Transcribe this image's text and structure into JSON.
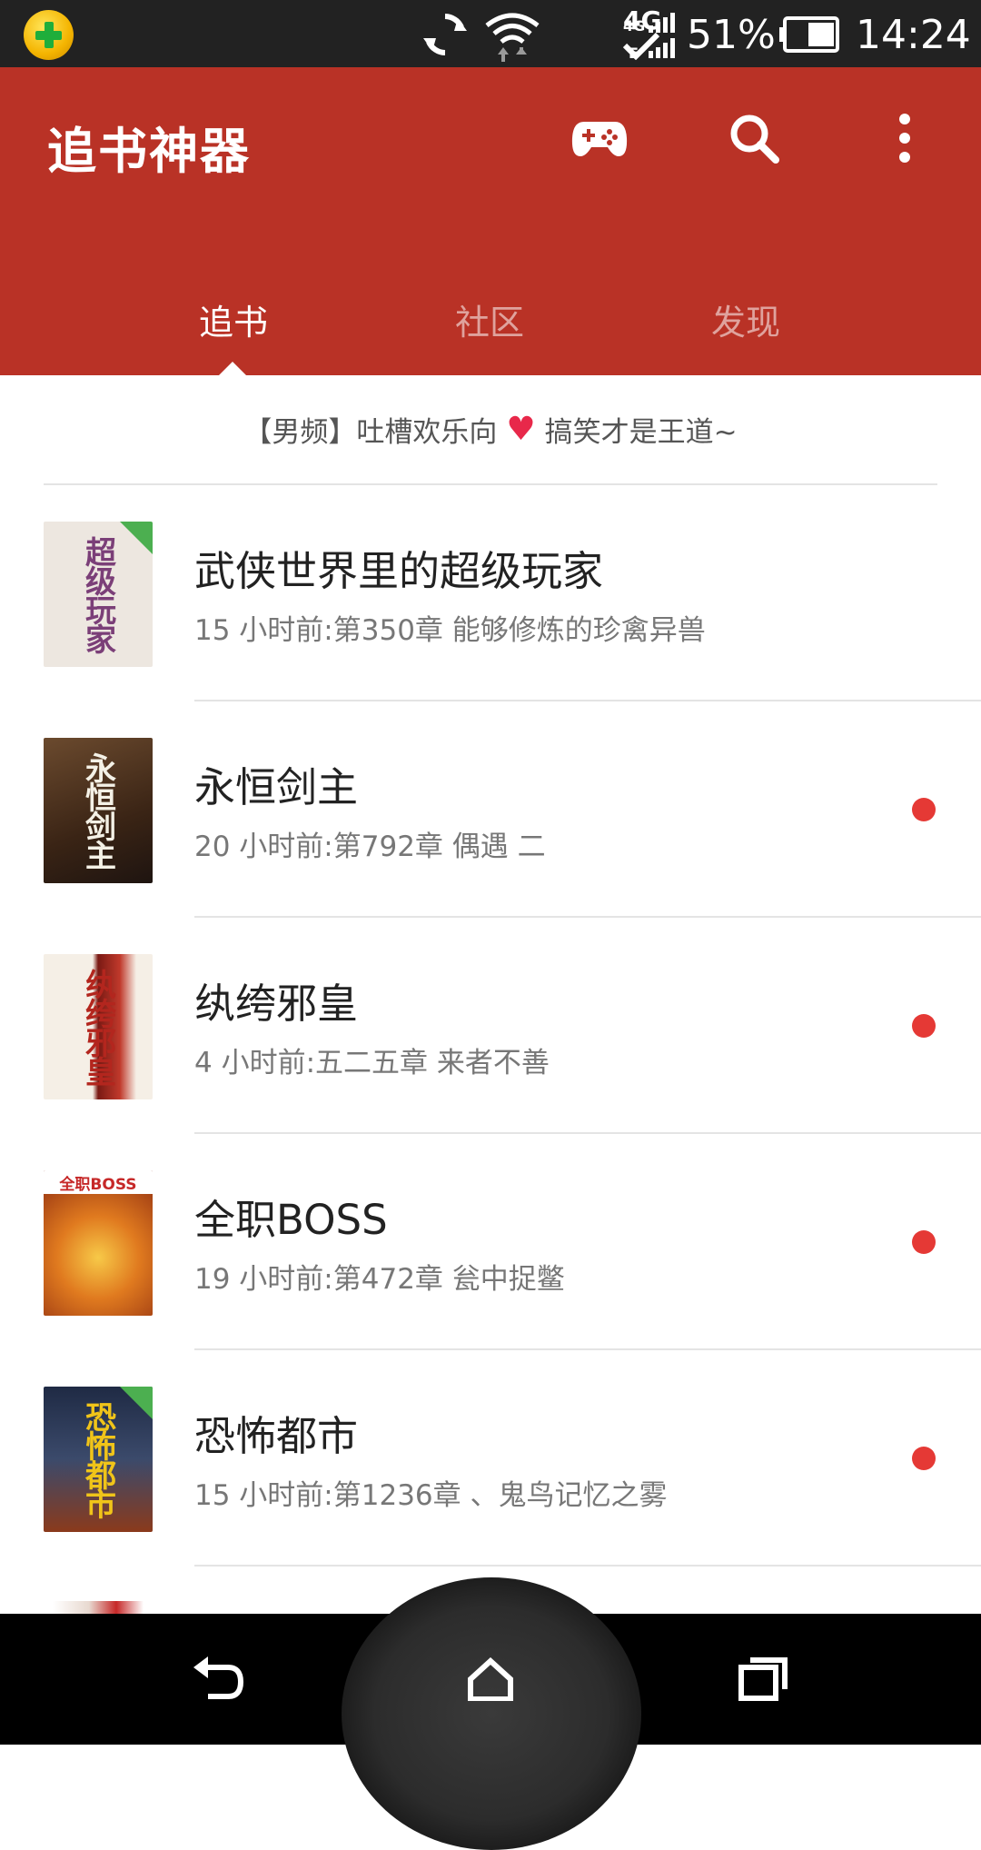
{
  "status_bar": {
    "battery_percent": "51%",
    "time": "14:24",
    "network_label": "4G",
    "icons": [
      "app-360-icon",
      "sync-icon",
      "wifi-icon",
      "4g-icon",
      "signal-icon",
      "battery-icon"
    ]
  },
  "header": {
    "title": "追书神器",
    "actions": [
      "gamepad-icon",
      "search-icon",
      "more-vert-icon"
    ],
    "accent_color": "#b93226"
  },
  "tabs": [
    {
      "label": "追书",
      "active": true
    },
    {
      "label": "社区",
      "active": false
    },
    {
      "label": "发现",
      "active": false
    }
  ],
  "promo": {
    "before": "【男频】吐槽欢乐向",
    "heart": "♥",
    "after": "搞笑才是王道~"
  },
  "books": [
    {
      "title": "武侠世界里的超级玩家",
      "update": "15 小时前:第350章 能够修炼的珍禽异兽",
      "unread": false,
      "cover_text": "超级玩家",
      "cover_bg": "#ede7e0",
      "cover_fg": "#7b3f78",
      "corner": true
    },
    {
      "title": "永恒剑主",
      "update": "20 小时前:第792章 偶遇 二",
      "unread": true,
      "cover_text": "永恒剑主",
      "cover_bg": "#4a2f1c",
      "cover_fg": "#f4f1e6",
      "corner": false
    },
    {
      "title": "纨绔邪皇",
      "update": "4 小时前:五二五章 来者不善",
      "unread": true,
      "cover_text": "纨绔邪皇",
      "cover_bg": "#f5efe6",
      "cover_fg": "#b3261e",
      "corner": false
    },
    {
      "title": "全职BOSS",
      "update": "19 小时前:第472章 瓮中捉鳖",
      "unread": true,
      "cover_text": "全职BOSS",
      "cover_bg": "#c2501d",
      "cover_fg": "#ffffff",
      "corner": false
    },
    {
      "title": "恐怖都市",
      "update": "15 小时前:第1236章 、鬼鸟记忆之雾",
      "unread": true,
      "cover_text": "恐怖都市",
      "cover_bg": "#2e3a52",
      "cover_fg": "#f0c419",
      "corner": true
    }
  ],
  "nav_bar": {
    "buttons": [
      "back-icon",
      "home-icon",
      "recents-icon"
    ]
  }
}
